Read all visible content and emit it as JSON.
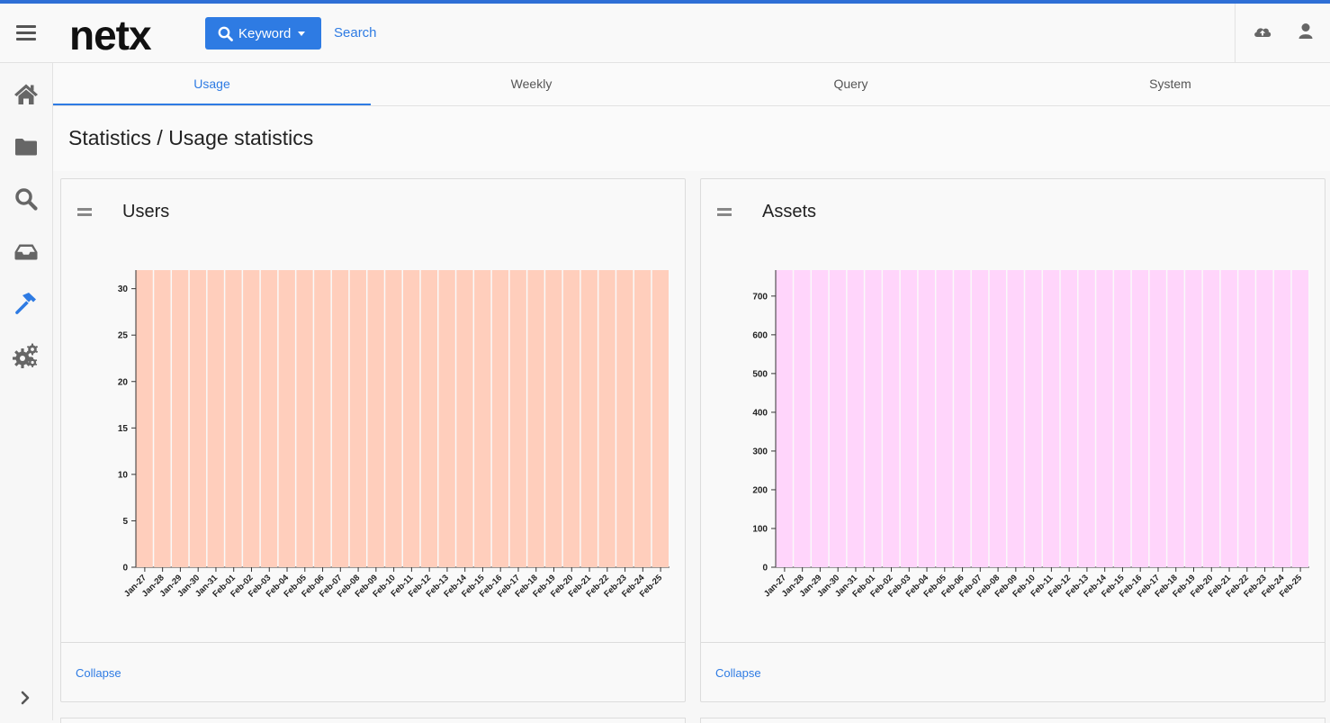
{
  "header": {
    "logo_text": "netx",
    "keyword_button": "Keyword",
    "search_link": "Search"
  },
  "sidebar": {
    "items": [
      {
        "icon": "home-icon"
      },
      {
        "icon": "folder-icon"
      },
      {
        "icon": "search-icon"
      },
      {
        "icon": "inbox-icon"
      },
      {
        "icon": "hammer-icon",
        "active": true
      },
      {
        "icon": "gears-icon"
      }
    ],
    "expand_icon": "chevron-right-icon"
  },
  "tabs": [
    {
      "label": "Usage",
      "active": true
    },
    {
      "label": "Weekly"
    },
    {
      "label": "Query"
    },
    {
      "label": "System"
    }
  ],
  "page_title": "Statistics / Usage statistics",
  "panels": [
    {
      "title": "Users",
      "collapse": "Collapse"
    },
    {
      "title": "Assets",
      "collapse": "Collapse"
    }
  ],
  "colors": {
    "accent": "#2e7be3",
    "users_bar": "#ffcebc",
    "assets_bar": "#ffd5fb"
  },
  "chart_data": [
    {
      "type": "bar",
      "categories": [
        "Jan-27",
        "Jan-28",
        "Jan-29",
        "Jan-30",
        "Jan-31",
        "Feb-01",
        "Feb-02",
        "Feb-03",
        "Feb-04",
        "Feb-05",
        "Feb-06",
        "Feb-07",
        "Feb-08",
        "Feb-09",
        "Feb-10",
        "Feb-11",
        "Feb-12",
        "Feb-13",
        "Feb-14",
        "Feb-15",
        "Feb-16",
        "Feb-17",
        "Feb-18",
        "Feb-19",
        "Feb-20",
        "Feb-21",
        "Feb-22",
        "Feb-23",
        "Feb-24",
        "Feb-25"
      ],
      "values": [
        32,
        32,
        32,
        32,
        32,
        32,
        32,
        32,
        32,
        32,
        32,
        32,
        32,
        32,
        32,
        32,
        32,
        32,
        32,
        32,
        32,
        32,
        32,
        32,
        32,
        32,
        32,
        32,
        32,
        32
      ],
      "yticks": [
        0,
        5,
        10,
        15,
        20,
        25,
        30
      ],
      "ylim": [
        0,
        32
      ],
      "grid": false
    },
    {
      "type": "bar",
      "categories": [
        "Jan-27",
        "Jan-28",
        "Jan-29",
        "Jan-30",
        "Jan-31",
        "Feb-01",
        "Feb-02",
        "Feb-03",
        "Feb-04",
        "Feb-05",
        "Feb-06",
        "Feb-07",
        "Feb-08",
        "Feb-09",
        "Feb-10",
        "Feb-11",
        "Feb-12",
        "Feb-13",
        "Feb-14",
        "Feb-15",
        "Feb-16",
        "Feb-17",
        "Feb-18",
        "Feb-19",
        "Feb-20",
        "Feb-21",
        "Feb-22",
        "Feb-23",
        "Feb-24",
        "Feb-25"
      ],
      "values": [
        767,
        767,
        767,
        767,
        767,
        767,
        767,
        767,
        767,
        767,
        767,
        767,
        767,
        767,
        767,
        767,
        767,
        767,
        767,
        767,
        767,
        767,
        767,
        767,
        767,
        767,
        767,
        767,
        767,
        767
      ],
      "yticks": [
        0,
        100,
        200,
        300,
        400,
        500,
        600,
        700
      ],
      "ylim": [
        0,
        767
      ],
      "grid": false
    }
  ]
}
